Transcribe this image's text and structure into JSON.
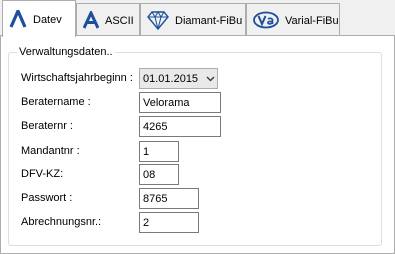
{
  "tabs": [
    {
      "label": "Datev",
      "icon": "datev-logo-icon",
      "active": true
    },
    {
      "label": "ASCII",
      "icon": "ascii-logo-icon",
      "active": false
    },
    {
      "label": "Diamant-FiBu",
      "icon": "diamond-icon",
      "active": false
    },
    {
      "label": "Varial-FiBu",
      "icon": "varial-logo-icon",
      "active": false
    }
  ],
  "group": {
    "title": "Verwaltungsdaten.."
  },
  "fields": {
    "wirtschaftsjahr": {
      "label": "Wirtschaftsjahrbeginn  :",
      "value": "01.01.2015"
    },
    "beratername": {
      "label": "Beratername :",
      "value": "Velorama"
    },
    "beraternr": {
      "label": "Beraternr :",
      "value": "4265"
    },
    "mandantnr": {
      "label": "Mandantnr :",
      "value": "1"
    },
    "dfv_kz": {
      "label": "DFV-KZ:",
      "value": "08"
    },
    "passwort": {
      "label": "Passwort :",
      "value": "8765"
    },
    "abrechnungsnr": {
      "label": "Abrechnungsnr.:",
      "value": "2"
    }
  },
  "colors": {
    "accent": "#1c4f9c",
    "border": "#adadad",
    "panel": "#ffffff"
  }
}
